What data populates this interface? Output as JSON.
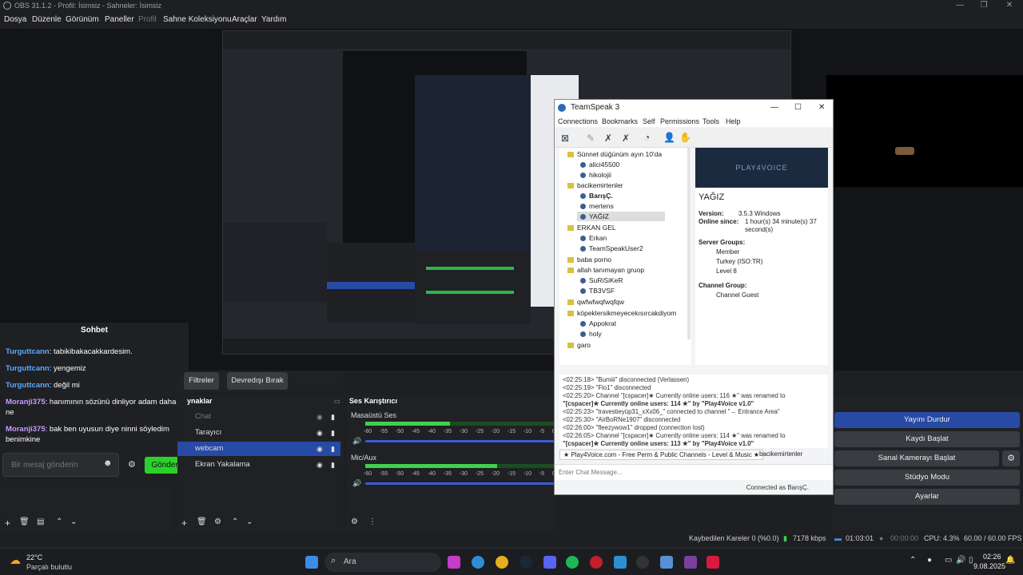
{
  "obs": {
    "title": "OBS 31.1.2 - Profil: İsimsiz - Sahneler: İsimsiz",
    "menu": [
      "Dosya",
      "Düzenle",
      "Görünüm",
      "Paneller",
      "Profil",
      "Sahne Koleksiyonu",
      "Araçlar",
      "Yardım"
    ]
  },
  "chat": {
    "title": "Sohbet",
    "messages": [
      {
        "user": "Turguttcann",
        "text": ": tabikibakacakkardesim.",
        "color": "#5aa9ff"
      },
      {
        "user": "Turguttcann",
        "text": ": yengemiz",
        "color": "#5aa9ff"
      },
      {
        "user": "Turguttcann",
        "text": ": değil mi",
        "color": "#5aa9ff"
      },
      {
        "user": "Moranji375",
        "text": ": hanımının sözünü dinliyor adam daha ne",
        "color": "#c79bff"
      },
      {
        "user": "Moranji375",
        "text": ": bak ben uyusun diye ninni söyledim benimkine",
        "color": "#c79bff"
      }
    ],
    "placeholder": "Bir mesaj gönderin",
    "send": "Gönder"
  },
  "filters": {
    "filters_label": "Filtreler",
    "disable_label": "Devredışı Bırak"
  },
  "sources": {
    "title": "ynaklar",
    "items": [
      {
        "name": "Chat",
        "selected": false
      },
      {
        "name": "Tarayıcı",
        "selected": false
      },
      {
        "name": "webcam",
        "selected": true
      },
      {
        "name": "Ekran Yakalama",
        "selected": false
      }
    ]
  },
  "mixer": {
    "title": "Ses Karıştırıcı",
    "channels": [
      {
        "name": "Masaüstü Ses",
        "level": 0.45
      },
      {
        "name": "Mic/Aux",
        "level": 0.7
      }
    ],
    "ticks": [
      "-60",
      "-55",
      "-50",
      "-45",
      "-40",
      "-35",
      "-30",
      "-25",
      "-20",
      "-15",
      "-10",
      "-5",
      "0"
    ]
  },
  "controls": [
    "Yayını Durdur",
    "Kaydı Başlat",
    "Sanal Kamerayı Başlat",
    "Stüdyo Modu",
    "Ayarlar"
  ],
  "status": {
    "dropped": "Kaybedilen Kareler 0 (%0.0)",
    "bitrate": "7178 kbps",
    "stream_time": "01:03:01",
    "rec_time": "00:00:00",
    "cpu": "CPU: 4.3%",
    "fps": "60.00 / 60.00 FPS"
  },
  "teamspeak": {
    "title": "TeamSpeak 3",
    "menu": [
      "Connections",
      "Bookmarks",
      "Self",
      "Permissions",
      "Tools",
      "Help"
    ],
    "tree": [
      {
        "type": "channel",
        "name": "Sünnet düğünüm ayın 10'da"
      },
      {
        "type": "user",
        "name": "alici45500",
        "badge": "23"
      },
      {
        "type": "user",
        "name": "hikolojii",
        "badge": "24"
      },
      {
        "type": "channel",
        "name": "bacikemirtenler"
      },
      {
        "type": "user",
        "name": "BarışÇ.",
        "badge": "8"
      },
      {
        "type": "user",
        "name": "mertens",
        "badge": "7"
      },
      {
        "type": "user",
        "name": "YAĞIZ",
        "badge": "8"
      },
      {
        "type": "channel",
        "name": "ERKAN GEL"
      },
      {
        "type": "user",
        "name": "Erkan",
        "badge": "11"
      },
      {
        "type": "user",
        "name": "TeamSpeakUser2",
        "badge": "9"
      },
      {
        "type": "channel",
        "name": "baba porno"
      },
      {
        "type": "channel",
        "name": "allah tanımayan gruop"
      },
      {
        "type": "user",
        "name": "SuRiSiKeR",
        "badge": "29"
      },
      {
        "type": "user",
        "name": "TB3VSF",
        "badge": "18"
      },
      {
        "type": "channel",
        "name": "qwfwfwqfwqfqw"
      },
      {
        "type": "channel",
        "name": "köpeklersikmeyecekısırcakdiyom"
      },
      {
        "type": "user",
        "name": "Appokrat",
        "badge": "27"
      },
      {
        "type": "user",
        "name": "holy",
        "badge": "25"
      },
      {
        "type": "channel",
        "name": "garo"
      }
    ],
    "banner": "PLAY4VOICE",
    "info": {
      "name": "YAĞIZ",
      "version_label": "Version:",
      "version": "3.5.3 Windows",
      "online_label": "Online since:",
      "online": "1 hour(s) 34 minute(s) 37 second(s)",
      "server_groups_label": "Server Groups:",
      "groups": [
        "Member",
        "Turkey (ISO:TR)",
        "Level 8"
      ],
      "channel_group_label": "Channel Group:",
      "channel_group": "Channel Guest"
    },
    "log": [
      "<02:25:18> \"Bumiii\" disconnected (Verlassen)",
      "<02:25:19> \"Flo1\" disconnected",
      "<02:25:20> Channel \"[cspacer]★ Currently online users: 116 ★\" was renamed to",
      "\"[cspacer]★ Currently online users: 114 ★\" by \"Play4Voice v1.0\"",
      "<02:25:23> \"travestieyüp31_xXx06_\" connected to channel \"→ Entrance Area\"",
      "<02:25:30> \"AirBoRNe1907\" disconnected",
      "<02:26:00> \"fleezywow1\" dropped (connection lost)",
      "<02:26:05> Channel \"[cspacer]★ Currently online users: 114 ★\" was renamed to",
      "\"[cspacer]★ Currently online users: 113 ★\" by \"Play4Voice v1.0\""
    ],
    "tab1": "★ Play4Voice.com - Free Perm & Public Channels - Level & Music ★",
    "tab2": "bacikemirtenler",
    "chat_placeholder": "Enter Chat Message...",
    "status": "Connected as BarışÇ."
  },
  "taskbar": {
    "weather_temp": "22°C",
    "weather_text": "Parçalı bulutlu",
    "search": "Ara",
    "time": "02:26",
    "date": "9.08.2025"
  }
}
